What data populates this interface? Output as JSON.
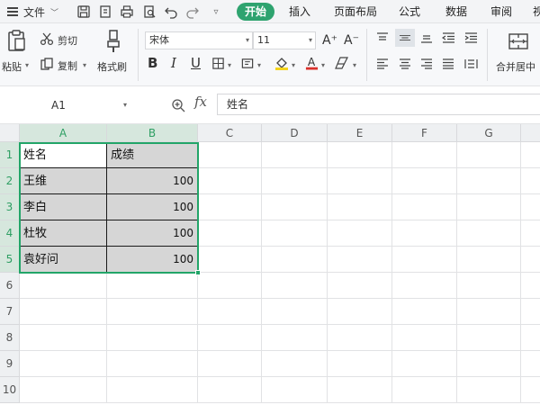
{
  "menubar": {
    "file_label": "文件",
    "tabs": [
      {
        "label": "开始",
        "active": true
      },
      {
        "label": "插入",
        "active": false
      },
      {
        "label": "页面布局",
        "active": false
      },
      {
        "label": "公式",
        "active": false
      },
      {
        "label": "数据",
        "active": false
      },
      {
        "label": "审阅",
        "active": false
      },
      {
        "label": "视",
        "active": false
      }
    ],
    "accent_color": "#2ea36f"
  },
  "ribbon": {
    "paste_label": "粘贴",
    "cut_label": "剪切",
    "copy_label": "复制",
    "format_painter_label": "格式刷",
    "font_name": "宋体",
    "font_size": "11",
    "merge_center_label": "合并居中"
  },
  "formula_bar": {
    "name_box": "A1",
    "fx_label": "fx",
    "content": "姓名"
  },
  "grid": {
    "columns": [
      "A",
      "B",
      "C",
      "D",
      "E",
      "F",
      "G"
    ],
    "rows": [
      "1",
      "2",
      "3",
      "4",
      "5",
      "6",
      "7",
      "8",
      "9",
      "10"
    ],
    "cells": [
      [
        "姓名",
        "成绩"
      ],
      [
        "王维",
        "100"
      ],
      [
        "李白",
        "100"
      ],
      [
        "杜牧",
        "100"
      ],
      [
        "袁好问",
        "100"
      ]
    ],
    "selection_color": "#22a568"
  }
}
